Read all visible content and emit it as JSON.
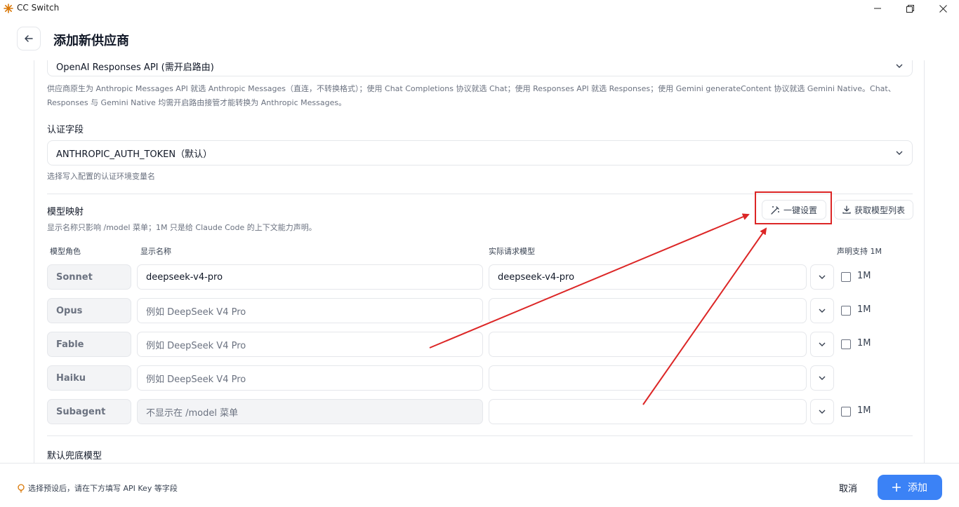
{
  "window": {
    "title": "CC Switch"
  },
  "header": {
    "title": "添加新供应商"
  },
  "api_format": {
    "selected": "OpenAI Responses API (需开启路由)",
    "hint_line1": "供应商原生为 Anthropic Messages API 就选 Anthropic Messages（直连，不转换格式）；使用 Chat Completions 协议就选 Chat；使用 Responses API 就选 Responses；使用 Gemini generateContent 协议就选 Gemini Native。Chat、",
    "hint_line2": "Responses 与 Gemini Native 均需开启路由接管才能转换为 Anthropic Messages。"
  },
  "auth_field": {
    "label": "认证字段",
    "selected": "ANTHROPIC_AUTH_TOKEN（默认）",
    "hint": "选择写入配置的认证环境变量名"
  },
  "model_mapping": {
    "title": "模型映射",
    "hint": "显示名称只影响 /model 菜单；1M 只是给 Claude Code 的上下文能力声明。",
    "one_click_label": "一键设置",
    "fetch_models_label": "获取模型列表",
    "columns": {
      "role": "模型角色",
      "display_name": "显示名称",
      "actual_model": "实际请求模型",
      "support_1m": "声明支持 1M"
    },
    "rows": [
      {
        "role": "Sonnet",
        "display": "deepseek-v4-pro",
        "display_placeholder": "",
        "actual": "deepseek-v4-pro",
        "has_1m": true,
        "checked": false,
        "m_label": "1M"
      },
      {
        "role": "Opus",
        "display": "",
        "display_placeholder": "例如 DeepSeek V4 Pro",
        "actual": "",
        "has_1m": true,
        "checked": false,
        "m_label": "1M"
      },
      {
        "role": "Fable",
        "display": "",
        "display_placeholder": "例如 DeepSeek V4 Pro",
        "actual": "",
        "has_1m": true,
        "checked": false,
        "m_label": "1M"
      },
      {
        "role": "Haiku",
        "display": "",
        "display_placeholder": "例如 DeepSeek V4 Pro",
        "actual": "",
        "has_1m": false,
        "checked": false,
        "m_label": ""
      },
      {
        "role": "Subagent",
        "display": "",
        "display_placeholder": "不显示在 /model 菜单",
        "actual": "",
        "has_1m": true,
        "checked": false,
        "m_label": "1M"
      }
    ]
  },
  "fallback": {
    "label": "默认兜底模型"
  },
  "footer": {
    "hint": "选择预设后，请在下方填写 API Key 等字段",
    "cancel_label": "取消",
    "add_label": "添加"
  },
  "colors": {
    "accent": "#3b82f6",
    "annotation": "#dc2626"
  }
}
